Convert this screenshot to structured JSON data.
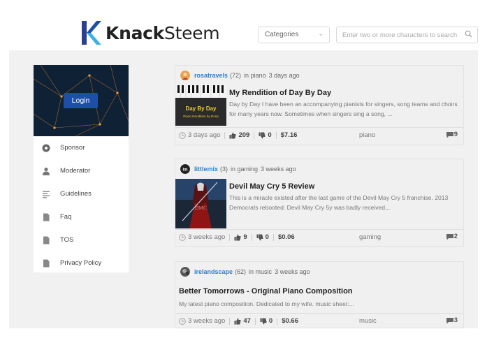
{
  "header": {
    "logo_bold": "Knack",
    "logo_light": "Steem",
    "category_select": "Categories",
    "search_placeholder": "Enter two or more characters to search",
    "brand_color": "#1e4fa8"
  },
  "sidebar": {
    "login_label": "Login",
    "items": [
      {
        "label": "Sponsor",
        "icon": "sponsor-icon"
      },
      {
        "label": "Moderator",
        "icon": "user-icon"
      },
      {
        "label": "Guidelines",
        "icon": "list-icon"
      },
      {
        "label": "Faq",
        "icon": "document-icon"
      },
      {
        "label": "TOS",
        "icon": "document-icon"
      },
      {
        "label": "Privacy Policy",
        "icon": "document-icon"
      }
    ]
  },
  "posts": [
    {
      "author": "rosatravels",
      "rep": "(72)",
      "category_text": "in piano",
      "time": "3 days ago",
      "title": "My Rendition of Day By Day",
      "excerpt": "Day by Day I have been an accompanying pianists for singers, song teams and choirs for many years now. Sometimes when singers sing a song, ...",
      "thumb_text_1": "Day By Day",
      "thumb_text_2": "Piano Rendition by Rosa",
      "foot_time": "3 days ago",
      "upvotes": "209",
      "downvotes": "0",
      "payout": "$7.16",
      "tag": "piano",
      "comments": "9"
    },
    {
      "author": "littlemix",
      "rep": "(3)",
      "category_text": "in gaming",
      "time": "3 weeks ago",
      "title": "Devil May Cry 5 Review",
      "excerpt": "This is a miracle existed after the last game of the Devil May Cry 5 franchise. 2013 Democrats rebooted: Devil May Cry 5y was badly received...",
      "foot_time": "3 weeks ago",
      "upvotes": "9",
      "downvotes": "0",
      "payout": "$0.06",
      "tag": "gaming",
      "comments": "2"
    },
    {
      "author": "irelandscape",
      "rep": "(62)",
      "category_text": "in music",
      "time": "3 weeks ago",
      "title": "Better Tomorrows - Original Piano Composition",
      "excerpt": "My latest piano composition. Dedicated to my wife. music sheet:...",
      "foot_time": "3 weeks ago",
      "upvotes": "47",
      "downvotes": "0",
      "payout": "$0.66",
      "tag": "music",
      "comments": "3"
    }
  ]
}
